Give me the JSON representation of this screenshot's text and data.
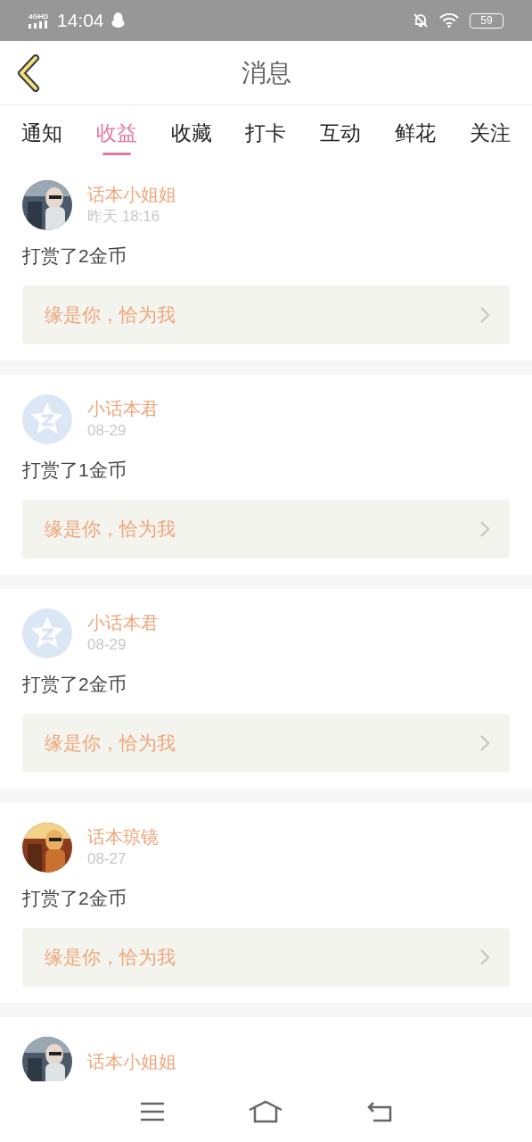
{
  "status_bar": {
    "network": "4GHD",
    "time": "14:04",
    "battery": "59"
  },
  "header": {
    "title": "消息"
  },
  "tabs": [
    {
      "label": "通知",
      "selected": false
    },
    {
      "label": "收益",
      "selected": true
    },
    {
      "label": "收藏",
      "selected": false
    },
    {
      "label": "打卡",
      "selected": false
    },
    {
      "label": "互动",
      "selected": false
    },
    {
      "label": "鲜花",
      "selected": false
    },
    {
      "label": "关注",
      "selected": false
    }
  ],
  "messages": [
    {
      "name": "话本小姐姐",
      "time": "昨天 18:16",
      "text": "打赏了2金币",
      "work": "缘是你，恰为我"
    },
    {
      "avatar": {
        "kind": "default"
      },
      "name": "小话本君",
      "time": "08-29",
      "text": "打赏了1金币",
      "work": "缘是你，恰为我"
    },
    {
      "avatar": {
        "kind": "default"
      },
      "name": "小话本君",
      "time": "08-29",
      "text": "打赏了2金币",
      "work": "缘是你，恰为我"
    },
    {
      "name": "话本琼镜",
      "time": "08-27",
      "text": "打赏了2金币",
      "work": "缘是你，恰为我"
    },
    {
      "name": "话本小姐姐"
    }
  ]
}
